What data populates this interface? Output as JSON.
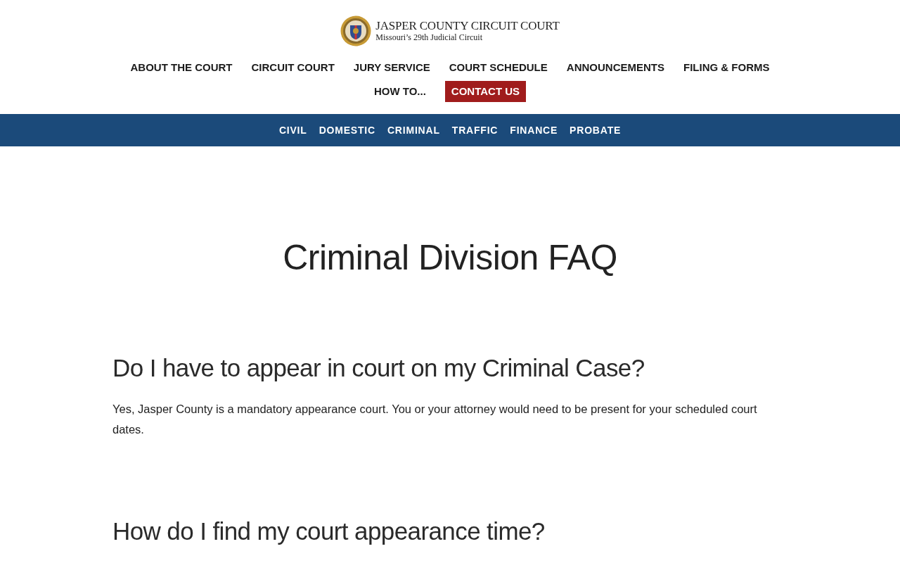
{
  "header": {
    "logo": {
      "title": "JASPER COUNTY CIRCUIT COURT",
      "subtitle": "Missouri’s 29th Judicial Circuit"
    },
    "nav": [
      {
        "label": "ABOUT THE COURT",
        "kind": "link"
      },
      {
        "label": "CIRCUIT COURT",
        "kind": "link"
      },
      {
        "label": "JURY SERVICE",
        "kind": "link"
      },
      {
        "label": "COURT SCHEDULE",
        "kind": "link"
      },
      {
        "label": "ANNOUNCEMENTS",
        "kind": "link"
      },
      {
        "label": "FILING & FORMS",
        "kind": "link"
      },
      {
        "label": "HOW TO...",
        "kind": "link"
      },
      {
        "label": "CONTACT US",
        "kind": "button"
      }
    ]
  },
  "subnav": [
    "CIVIL",
    "DOMESTIC",
    "CRIMINAL",
    "TRAFFIC",
    "FINANCE",
    "PROBATE"
  ],
  "page": {
    "title": "Criminal Division FAQ",
    "faq": [
      {
        "question": "Do I have to appear in court on my Criminal Case?",
        "answer": "Yes, Jasper County is a mandatory appearance court. You or your attorney would need to be present for your scheduled court dates."
      },
      {
        "question": "How do I find my court appearance time?"
      }
    ]
  }
}
